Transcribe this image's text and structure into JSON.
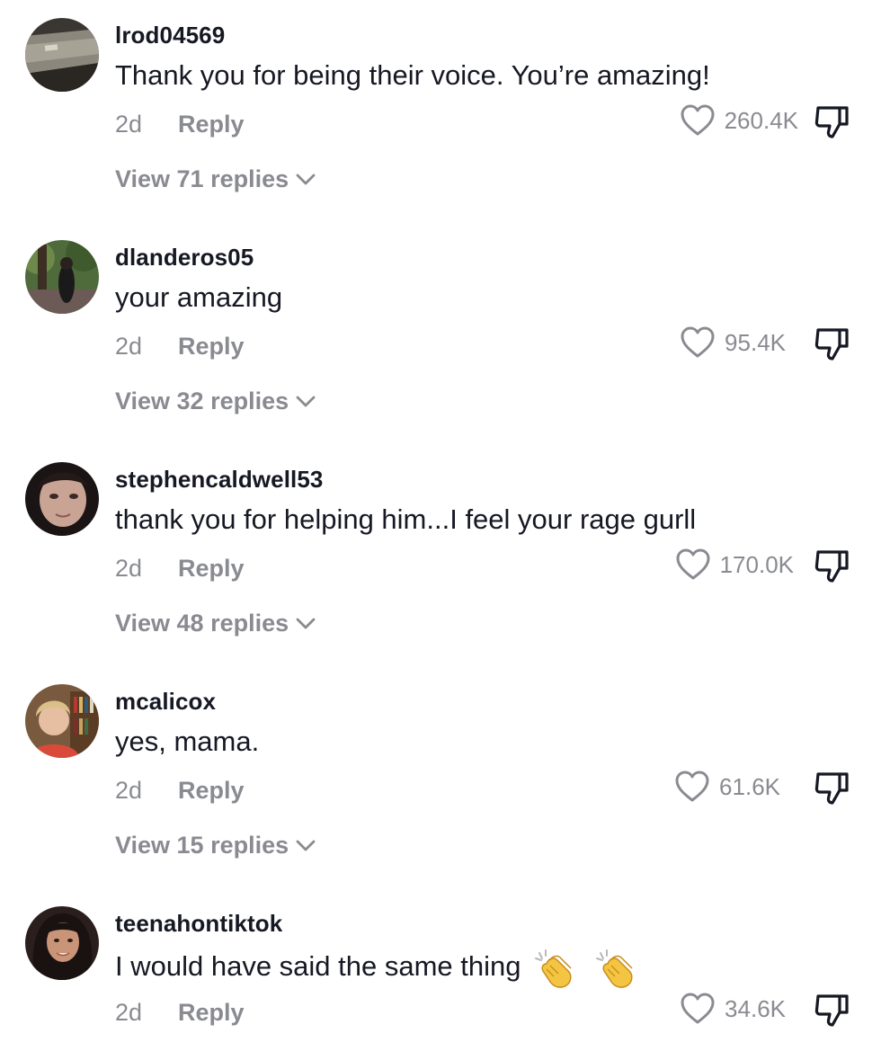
{
  "colors": {
    "text": "#161823",
    "muted": "#8a8b91",
    "background": "#ffffff"
  },
  "comments": [
    {
      "username": "lrod04569",
      "text": "Thank you for being their voice. You’re amazing!",
      "time": "2d",
      "reply_label": "Reply",
      "likes": "260.4K",
      "view_replies": "View 71 replies",
      "icons": [
        "heart-icon",
        "thumbs-down-icon",
        "chevron-down-icon"
      ]
    },
    {
      "username": "dlanderos05",
      "text": "your amazing",
      "time": "2d",
      "reply_label": "Reply",
      "likes": "95.4K",
      "view_replies": "View 32 replies",
      "icons": [
        "heart-icon",
        "thumbs-down-icon",
        "chevron-down-icon"
      ]
    },
    {
      "username": "stephencaldwell53",
      "text": "thank you for helping him...I feel your rage gurll",
      "time": "2d",
      "reply_label": "Reply",
      "likes": "170.0K",
      "view_replies": "View 48 replies",
      "icons": [
        "heart-icon",
        "thumbs-down-icon",
        "chevron-down-icon"
      ]
    },
    {
      "username": "mcalicox",
      "text": "yes, mama.",
      "time": "2d",
      "reply_label": "Reply",
      "likes": "61.6K",
      "view_replies": "View 15 replies",
      "icons": [
        "heart-icon",
        "thumbs-down-icon",
        "chevron-down-icon"
      ]
    },
    {
      "username": "teenahontiktok",
      "text": "I would have said the same thing",
      "emojis": [
        "clapping-hands-emoji",
        "clapping-hands-emoji"
      ],
      "time": "2d",
      "reply_label": "Reply",
      "likes": "34.6K",
      "icons": [
        "heart-icon",
        "thumbs-down-icon"
      ]
    }
  ]
}
